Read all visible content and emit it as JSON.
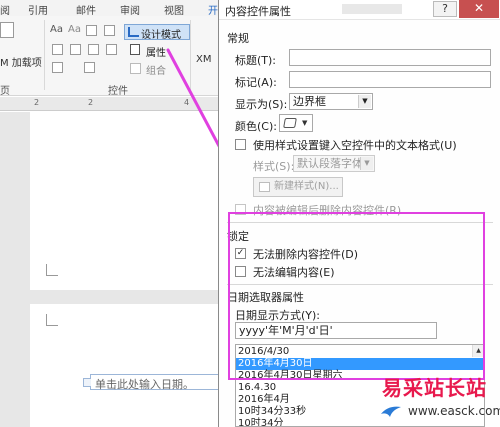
{
  "ribbon": {
    "tabs": [
      "引用",
      "邮件",
      "审阅",
      "视图",
      "开"
    ],
    "tab_fragment": "阅",
    "addin_label": "M 加载项",
    "design_mode": "设计模式",
    "properties": "属性",
    "group": "组合",
    "group_label": "控件",
    "xml": "XM",
    "side_label": "页",
    "aa": "Aa"
  },
  "ruler": {
    "numbers": [
      "2",
      "2",
      "4"
    ]
  },
  "document": {
    "placeholder": "单击此处输入日期。"
  },
  "dialog": {
    "title": "内容控件属性",
    "help": "?",
    "close": "✕",
    "general": {
      "section": "常规",
      "title_label": "标题(T):",
      "tag_label": "标记(A):",
      "show_as_label": "显示为(S):",
      "show_as_value": "边界框",
      "color_label": "颜色(C):",
      "use_style_label": "使用样式设置键入空控件中的文本格式(U)",
      "style_label": "样式(S):",
      "style_value": "默认段落字体",
      "new_style": "新建样式(N)...",
      "remove_label": "内容被编辑后删除内容控件(R)"
    },
    "locking": {
      "section": "锁定",
      "no_delete": "无法删除内容控件(D)",
      "no_delete_checked": "✓",
      "no_edit": "无法编辑内容(E)"
    },
    "date_picker": {
      "section": "日期选取器属性",
      "format_label": "日期显示方式(Y):",
      "format_value": "yyyy'年'M'月'd'日'",
      "formats": [
        "2016/4/30",
        "2016年4月30日",
        "2016年4月30日星期六",
        "16.4.30",
        "2016年4月",
        "10时34分33秒",
        "10时34分"
      ],
      "selected_index": 1
    }
  },
  "watermark": {
    "text": "易采站长站",
    "url": "www.easck.com"
  },
  "colors": {
    "highlight": "#e040e0",
    "selection": "#3399ff",
    "watermark": "#e8194d"
  }
}
